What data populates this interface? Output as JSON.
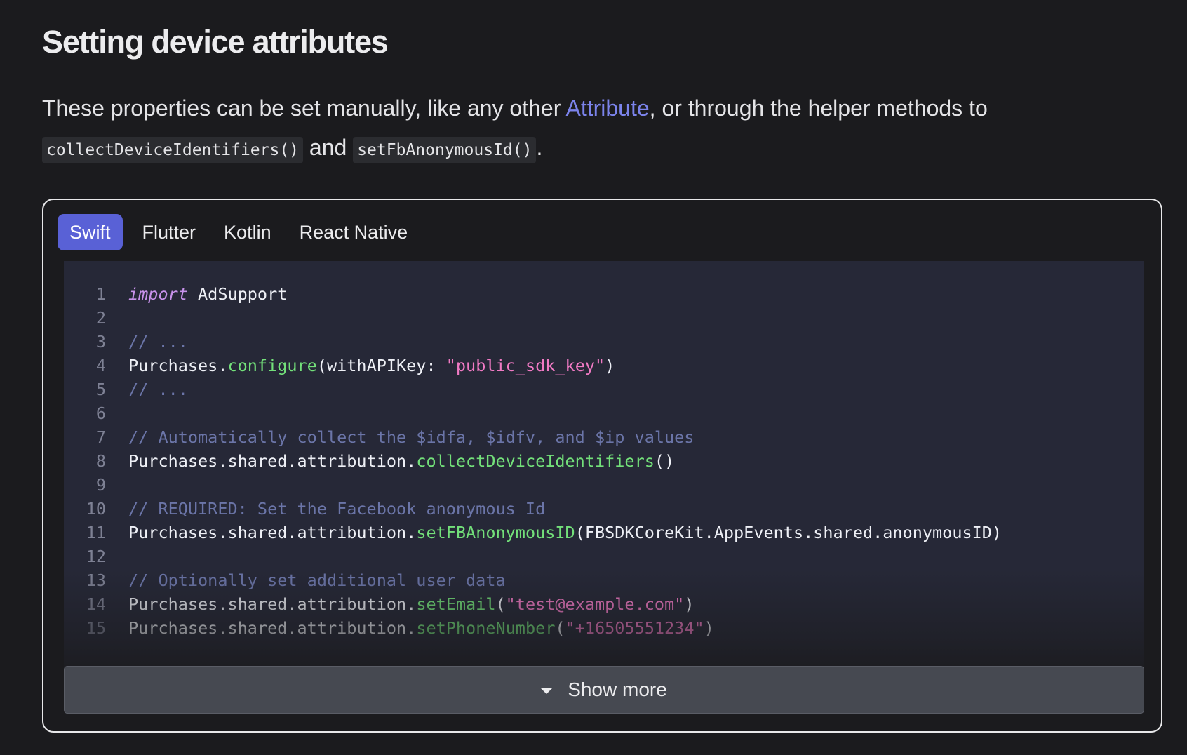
{
  "heading": "Setting device attributes",
  "intro": {
    "text_before_link": "These properties can be set manually, like any other ",
    "link_text": "Attribute",
    "text_after_link": ", or through the helper methods to",
    "code_1": "collectDeviceIdentifiers()",
    "conjunction": " and ",
    "code_2": "setFbAnonymousId()",
    "end": "."
  },
  "tabs": [
    {
      "label": "Swift",
      "active": true
    },
    {
      "label": "Flutter",
      "active": false
    },
    {
      "label": "Kotlin",
      "active": false
    },
    {
      "label": "React Native",
      "active": false
    }
  ],
  "code": {
    "language": "swift",
    "lines": [
      {
        "n": "1",
        "tokens": [
          {
            "t": "import",
            "k": "kw"
          },
          {
            "t": " AdSupport",
            "k": "plain"
          }
        ]
      },
      {
        "n": "2",
        "tokens": []
      },
      {
        "n": "3",
        "tokens": [
          {
            "t": "// ...",
            "k": "comment"
          }
        ]
      },
      {
        "n": "4",
        "tokens": [
          {
            "t": "Purchases.",
            "k": "plain"
          },
          {
            "t": "configure",
            "k": "fn"
          },
          {
            "t": "(withAPIKey: ",
            "k": "plain"
          },
          {
            "t": "\"public_sdk_key\"",
            "k": "str"
          },
          {
            "t": ")",
            "k": "plain"
          }
        ]
      },
      {
        "n": "5",
        "tokens": [
          {
            "t": "// ...",
            "k": "comment"
          }
        ]
      },
      {
        "n": "6",
        "tokens": []
      },
      {
        "n": "7",
        "tokens": [
          {
            "t": "// Automatically collect the $idfa, $idfv, and $ip values",
            "k": "comment"
          }
        ]
      },
      {
        "n": "8",
        "tokens": [
          {
            "t": "Purchases.shared.attribution.",
            "k": "plain"
          },
          {
            "t": "collectDeviceIdentifiers",
            "k": "fn"
          },
          {
            "t": "()",
            "k": "plain"
          }
        ]
      },
      {
        "n": "9",
        "tokens": []
      },
      {
        "n": "10",
        "tokens": [
          {
            "t": "// REQUIRED: Set the Facebook anonymous Id",
            "k": "comment"
          }
        ]
      },
      {
        "n": "11",
        "tokens": [
          {
            "t": "Purchases.shared.attribution.",
            "k": "plain"
          },
          {
            "t": "setFBAnonymousID",
            "k": "fn"
          },
          {
            "t": "(FBSDKCoreKit.AppEvents.shared.anonymousID)",
            "k": "plain"
          }
        ]
      },
      {
        "n": "12",
        "tokens": []
      },
      {
        "n": "13",
        "tokens": [
          {
            "t": "// Optionally set additional user data",
            "k": "comment"
          }
        ]
      },
      {
        "n": "14",
        "tokens": [
          {
            "t": "Purchases.shared.attribution.",
            "k": "plain"
          },
          {
            "t": "setEmail",
            "k": "fn"
          },
          {
            "t": "(",
            "k": "plain"
          },
          {
            "t": "\"test@example.com\"",
            "k": "str"
          },
          {
            "t": ")",
            "k": "plain"
          }
        ]
      },
      {
        "n": "15",
        "tokens": [
          {
            "t": "Purchases.shared.attribution.",
            "k": "plain"
          },
          {
            "t": "setPhoneNumber",
            "k": "fn"
          },
          {
            "t": "(",
            "k": "plain"
          },
          {
            "t": "\"+16505551234\"",
            "k": "str"
          },
          {
            "t": ")",
            "k": "plain"
          }
        ]
      }
    ]
  },
  "show_more_label": "Show more",
  "icons": {
    "show_more": "caret-down-icon"
  },
  "colors": {
    "accent": "#5961d6",
    "link": "#7b83eb",
    "background": "#1b1b1e",
    "code_background": "#262837"
  }
}
